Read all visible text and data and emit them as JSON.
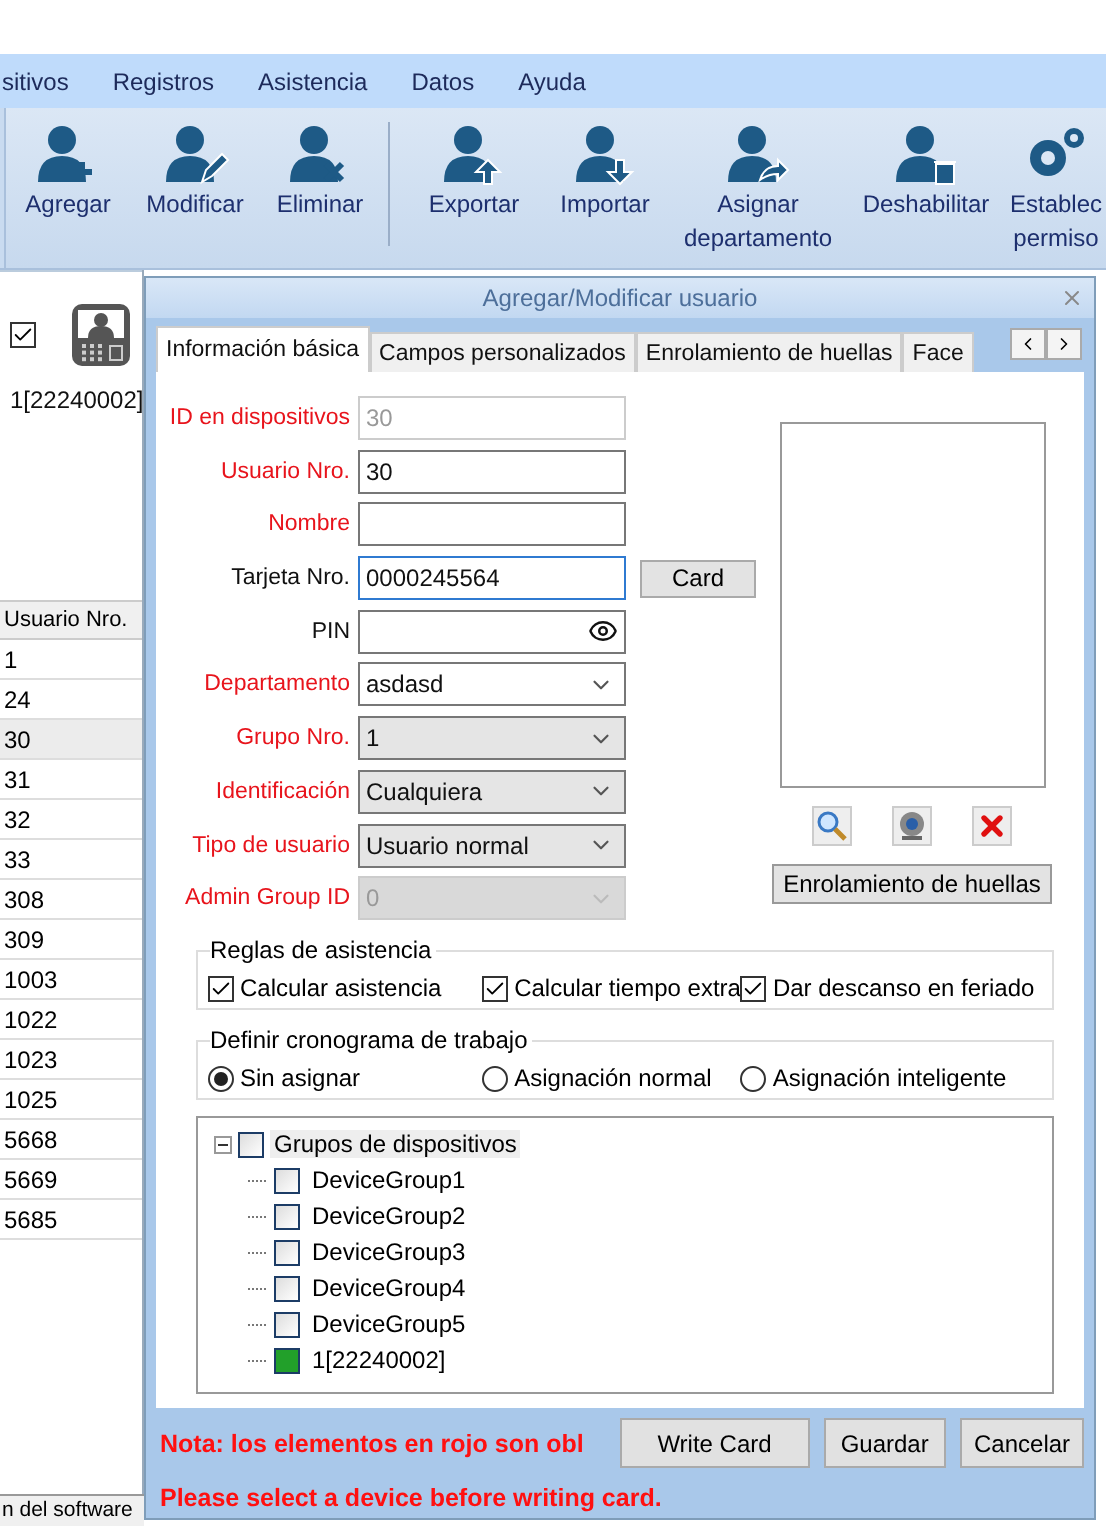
{
  "menu": [
    {
      "label": "sitivos"
    },
    {
      "label": "Registros"
    },
    {
      "label": "Asistencia"
    },
    {
      "label": "Datos"
    },
    {
      "label": "Ayuda"
    }
  ],
  "toolbar": [
    {
      "kind": "add",
      "lines": [
        "Agregar"
      ]
    },
    {
      "kind": "edit",
      "lines": [
        "Modificar"
      ]
    },
    {
      "kind": "delete",
      "lines": [
        "Eliminar"
      ]
    },
    {
      "kind": "export",
      "lines": [
        "Exportar"
      ]
    },
    {
      "kind": "import",
      "lines": [
        "Importar"
      ]
    },
    {
      "kind": "assign",
      "lines": [
        "Asignar",
        "departamento"
      ]
    },
    {
      "kind": "disable",
      "lines": [
        "Deshabilitar"
      ]
    },
    {
      "kind": "settings",
      "lines": [
        "Establec",
        "permiso"
      ]
    }
  ],
  "device_panel": {
    "checked": true,
    "label": "1[22240002]"
  },
  "user_table": {
    "columns": [
      "Usuario Nro."
    ],
    "rows": [
      {
        "cells": [
          "1"
        ],
        "selected": false
      },
      {
        "cells": [
          "24"
        ],
        "selected": false
      },
      {
        "cells": [
          "30"
        ],
        "selected": true
      },
      {
        "cells": [
          "31"
        ],
        "selected": false
      },
      {
        "cells": [
          "32"
        ],
        "selected": false
      },
      {
        "cells": [
          "33"
        ],
        "selected": false
      },
      {
        "cells": [
          "308"
        ],
        "selected": false
      },
      {
        "cells": [
          "309"
        ],
        "selected": false
      },
      {
        "cells": [
          "1003"
        ],
        "selected": false
      },
      {
        "cells": [
          "1022"
        ],
        "selected": false
      },
      {
        "cells": [
          "1023"
        ],
        "selected": false
      },
      {
        "cells": [
          "1025"
        ],
        "selected": false
      },
      {
        "cells": [
          "5668"
        ],
        "selected": false
      },
      {
        "cells": [
          "5669"
        ],
        "selected": false
      },
      {
        "cells": [
          "5685"
        ],
        "selected": false
      }
    ]
  },
  "status_bar": {
    "text": "n del software"
  },
  "dialog": {
    "title": "Agregar/Modificar usuario",
    "tabs": [
      {
        "label": "Información básica",
        "selected": true
      },
      {
        "label": "Campos personalizados",
        "selected": false
      },
      {
        "label": "Enrolamiento de huellas",
        "selected": false
      },
      {
        "label": "Face",
        "selected": false
      }
    ],
    "fields": [
      {
        "label": "ID en dispositivos",
        "required": true,
        "kind": "text",
        "value": "30",
        "disabled": true,
        "focused": false
      },
      {
        "label": "Usuario Nro.",
        "required": true,
        "kind": "text",
        "value": "30",
        "disabled": false,
        "focused": false
      },
      {
        "label": "Nombre",
        "required": true,
        "kind": "text",
        "disabled": false,
        "focused": false
      },
      {
        "label": "Tarjeta Nro.",
        "required": false,
        "kind": "text",
        "value": "0000245564",
        "disabled": false,
        "focused": true
      },
      {
        "label": "PIN",
        "required": false,
        "kind": "password",
        "disabled": false,
        "focused": false
      },
      {
        "label": "Departamento",
        "required": true,
        "kind": "combo",
        "value": "asdasd",
        "disabled": false,
        "focused": false
      },
      {
        "label": "Grupo Nro.",
        "required": true,
        "kind": "select",
        "value": "1",
        "disabled": false,
        "focused": false
      },
      {
        "label": "Identificación",
        "required": true,
        "kind": "select",
        "value": "Cualquiera",
        "disabled": false,
        "focused": false
      },
      {
        "label": "Tipo de usuario",
        "required": true,
        "kind": "select",
        "value": "Usuario normal",
        "disabled": false,
        "focused": false
      },
      {
        "label": "Admin Group ID",
        "required": true,
        "kind": "select",
        "value": "0",
        "disabled": true,
        "focused": false
      }
    ],
    "card_button": "Card",
    "enroll_button": "Enrolamiento de huellas",
    "attendance_rules": {
      "title": "Reglas de asistencia",
      "options": [
        {
          "label": "Calcular asistencia",
          "checked": true
        },
        {
          "label": "Calcular tiempo extra",
          "checked": true
        },
        {
          "label": "Dar descanso en feriado",
          "checked": true
        }
      ]
    },
    "schedule": {
      "title": "Definir cronograma de trabajo",
      "options": [
        {
          "label": "Sin asignar",
          "selected": true
        },
        {
          "label": "Asignación normal",
          "selected": false
        },
        {
          "label": "Asignación inteligente",
          "selected": false
        }
      ]
    },
    "device_tree": {
      "label": "Grupos de dispositivos",
      "checked": false,
      "expanded": true,
      "selected": true,
      "children": [
        {
          "label": "DeviceGroup1",
          "kind": "group",
          "checked": false,
          "selected": false
        },
        {
          "label": "DeviceGroup2",
          "kind": "group",
          "checked": false,
          "selected": false
        },
        {
          "label": "DeviceGroup3",
          "kind": "group",
          "checked": false,
          "selected": false
        },
        {
          "label": "DeviceGroup4",
          "kind": "group",
          "checked": false,
          "selected": false
        },
        {
          "label": "DeviceGroup5",
          "kind": "group",
          "checked": false,
          "selected": false
        },
        {
          "label": "1[22240002]",
          "kind": "device",
          "checked": false,
          "selected": false
        }
      ]
    },
    "note": "Nota: los elementos en rojo son obl",
    "warning": "Please select a device before writing card.",
    "buttons": [
      "Write Card",
      "Guardar",
      "Cancelar"
    ]
  }
}
